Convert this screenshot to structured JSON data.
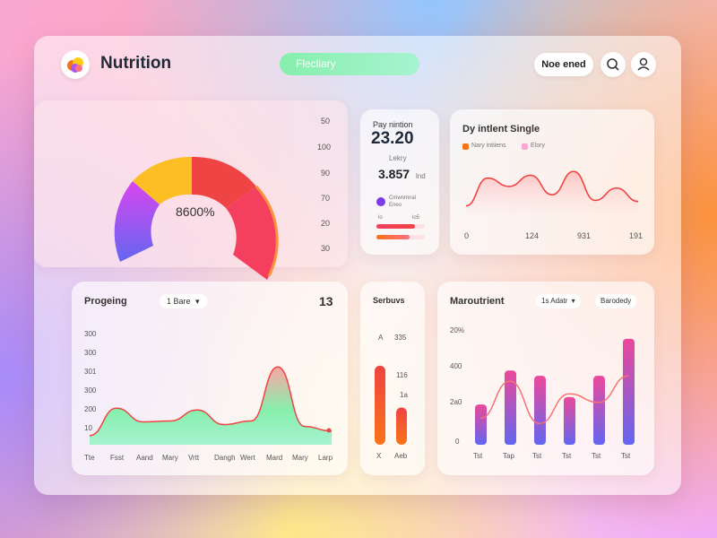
{
  "header": {
    "brand": "Nutrition",
    "search_pill": "Flecliary",
    "new_button": "Noe ened",
    "search_icon": "search-icon",
    "user_icon": "user-icon"
  },
  "gauge": {
    "value_label": "8600%",
    "scale": [
      "50",
      "100",
      "90",
      "70",
      "20",
      "30"
    ]
  },
  "daily": {
    "title": "Pay nintion",
    "value": "23.20",
    "sub_label": "Lekry",
    "sub_value": "3.857",
    "sub_unit": "lnd",
    "item_label": "Cmwnmnal",
    "item_sub": "Eneo",
    "bar_left": "lo",
    "bar_right": "lo5",
    "bars": [
      0.8,
      0.68
    ]
  },
  "trend": {
    "title": "Dy intlent Single",
    "legend": [
      "Nary intiiens",
      "Elory"
    ],
    "xticks": [
      "0",
      "124",
      "931",
      "191"
    ],
    "colors": {
      "a": "#f97316",
      "b": "#f472b6"
    }
  },
  "progress": {
    "title": "Progeing",
    "dropdown": "1 Bare",
    "count": "13",
    "yticks": [
      "300",
      "300",
      "301",
      "300",
      "200",
      "10"
    ],
    "xticks": [
      "Tte",
      "Fsst",
      "Aand",
      "Mary",
      "Vrtt",
      "Dangh",
      "Wert",
      "Mard",
      "Mary",
      "Larp"
    ]
  },
  "servings": {
    "title": "Serbuvs",
    "ticks": [
      "A",
      "335",
      "116",
      "1a"
    ],
    "xlabels": [
      "X",
      "Aeb"
    ],
    "values": [
      0.7,
      0.33
    ]
  },
  "macro": {
    "title": "Maroutrient",
    "dropdown": "1s Adatr",
    "filter": "Barodedy",
    "yticks": [
      "20%",
      "400",
      "2a0",
      "0"
    ],
    "xticks": [
      "Tst",
      "Tap",
      "Tst",
      "Tst",
      "Tst",
      "Tst"
    ]
  },
  "chart_data": [
    {
      "type": "line",
      "title": "Dy intlent Single",
      "x": [
        "0",
        "124",
        "931",
        "191"
      ],
      "series": [
        {
          "name": "Nary intiiens",
          "values": [
            20,
            70,
            55,
            75,
            40,
            82,
            30,
            52,
            28
          ]
        }
      ],
      "ylim": [
        0,
        100
      ]
    },
    {
      "type": "area",
      "title": "Progeing",
      "categories": [
        "Tte",
        "Fsst",
        "Aand",
        "Mary",
        "Vrtt",
        "Dangh",
        "Wert",
        "Mard",
        "Mary",
        "Larp"
      ],
      "series": [
        {
          "name": "",
          "values": [
            10,
            40,
            25,
            26,
            38,
            22,
            26,
            85,
            20,
            15
          ]
        }
      ],
      "ylim": [
        0,
        100
      ]
    },
    {
      "type": "bar",
      "title": "Serbuvs",
      "categories": [
        "X",
        "Aeb"
      ],
      "values": [
        70,
        33
      ],
      "ylim": [
        0,
        100
      ]
    },
    {
      "type": "bar",
      "title": "Maroutrient",
      "categories": [
        "Tst",
        "Tap",
        "Tst",
        "Tst",
        "Tst",
        "Tst",
        "Tst"
      ],
      "series": [
        {
          "name": "",
          "values": [
            38,
            70,
            65,
            45,
            65,
            100
          ]
        },
        {
          "name": "",
          "values": [
            25,
            60,
            20,
            48,
            40,
            65
          ]
        }
      ],
      "ylim": [
        0,
        110
      ]
    }
  ]
}
